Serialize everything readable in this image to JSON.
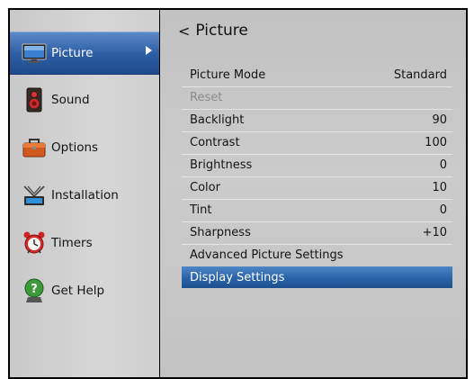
{
  "sidebar": {
    "items": [
      {
        "label": "Picture",
        "selected": true
      },
      {
        "label": "Sound"
      },
      {
        "label": "Options"
      },
      {
        "label": "Installation"
      },
      {
        "label": "Timers"
      },
      {
        "label": "Get Help"
      }
    ]
  },
  "header": {
    "back_glyph": "<",
    "title": "Picture"
  },
  "settings": [
    {
      "label": "Picture Mode",
      "value": "Standard"
    },
    {
      "label": "Reset",
      "value": "",
      "disabled": true
    },
    {
      "label": "Backlight",
      "value": "90"
    },
    {
      "label": "Contrast",
      "value": "100"
    },
    {
      "label": "Brightness",
      "value": "0"
    },
    {
      "label": "Color",
      "value": "10"
    },
    {
      "label": "Tint",
      "value": "0"
    },
    {
      "label": "Sharpness",
      "value": "+10"
    },
    {
      "label": "Advanced Picture Settings",
      "value": ""
    },
    {
      "label": "Display Settings",
      "value": "",
      "highlighted": true
    }
  ],
  "colors": {
    "selection_blue": "#2f5fa6",
    "panel_gray": "#c8c8c8",
    "disabled_text": "#8a8a8a"
  },
  "icons": [
    "tv-icon",
    "speaker-icon",
    "toolbox-icon",
    "antenna-icon",
    "alarm-clock-icon",
    "help-icon",
    "chevron-right-icon",
    "back-arrow-icon"
  ]
}
